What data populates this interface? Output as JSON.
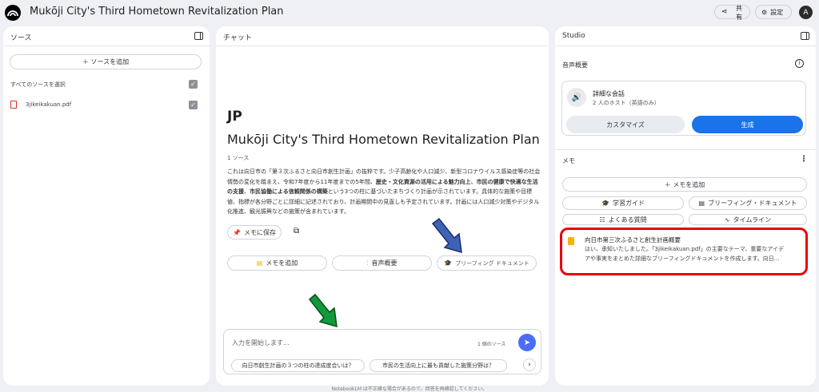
{
  "header": {
    "title": "Mukōji City's Third Hometown Revitalization Plan",
    "share_line1": "共",
    "share_line2": "有",
    "settings_label": "設定",
    "avatar_letter": "A"
  },
  "sources": {
    "title": "ソース",
    "add_label": "＋ ソースを追加",
    "select_all_label": "すべてのソースを選択",
    "files": [
      {
        "name": "3jikeikakuan.pdf"
      }
    ]
  },
  "chat": {
    "title": "チャット",
    "icon_emoji": "JP",
    "notebook_title": "Mukōji City's Third Hometown Revitalization Plan",
    "source_count": "1 ソース",
    "summary_parts": [
      "これは向日市の「第３次ふるさと向日市創生計画」の抜粋です。少子高齢化や人口減少、新型コロナウイルス感染症等の社会情勢の変化を踏まえ、令和7年度から11年度までの5年間、",
      "歴史・文化資源の活用による魅力向上",
      "、",
      "市民の健康で快適な生活の支援",
      "、",
      "市民協働による信頼関係の構築",
      "という3つの柱に基づいたまちづくり計画が示されています。具体的な施策や目標値、指標が各分野ごとに詳細に記述されており、計画期間中の見直しも予定されています。計画には人口減少対策やデジタル化推進、観光振興などの施策が含まれています。"
    ],
    "save_memo_label": "メモに保存",
    "actions": [
      {
        "label": "メモを追加"
      },
      {
        "label": "音声概要"
      },
      {
        "label": "ブリーフィング ドキュメント"
      }
    ],
    "input_placeholder": "入力を開始します...",
    "input_source_count": "1 個のソース",
    "suggestions": [
      "向日市創生計画の３つの柱の達成度合いは？",
      "市民の生活向上に最も貢献した施策分野は？"
    ],
    "footer_note": "NotebookLM は不正確な場合があるので、回答を再確認してください。"
  },
  "studio": {
    "title": "Studio",
    "audio_overview_title": "音声概要",
    "audio_card_title": "詳細な会話",
    "audio_card_subtitle": "2 人のホスト（英語のみ）",
    "customize_label": "カスタマイズ",
    "generate_label": "生成",
    "memo_title": "メモ",
    "add_memo_label": "＋ メモを追加",
    "memo_buttons": [
      {
        "label": "学習ガイド"
      },
      {
        "label": "ブリーフィング・ドキュメント"
      },
      {
        "label": "よくある質問"
      },
      {
        "label": "タイムライン"
      }
    ],
    "note": {
      "title": "向日市第三次ふるさと創生計画概要",
      "preview_line1": "はい、承知いたしました。「3jikeikakuan.pdf」の主要なテーマ、重要なアイデ",
      "preview_line2": "アや事実をまとめた詳細なブリーフィングドキュメントを作成します。向日..."
    }
  },
  "colors": {
    "accent_blue": "#1a73e8",
    "send_blue": "#4b6cf5",
    "highlight_red": "#e8000b",
    "arrow_blue": "#3d63b8",
    "arrow_green": "#129a3a"
  }
}
